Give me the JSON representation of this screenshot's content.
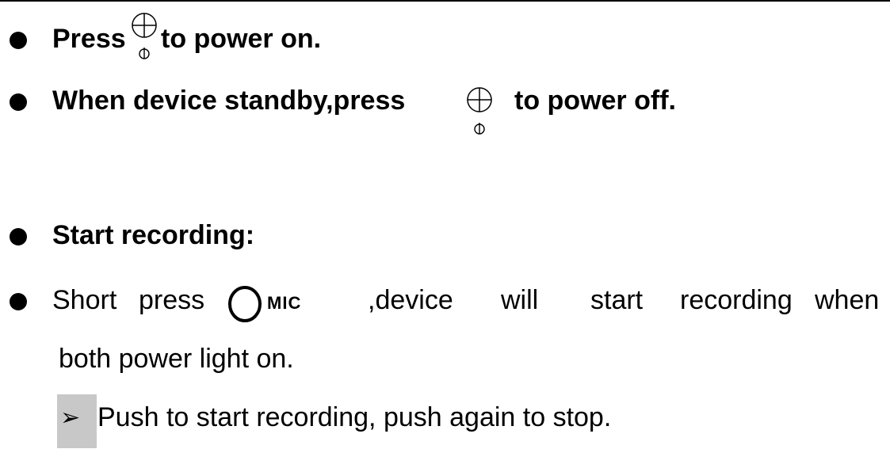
{
  "items": [
    {
      "before": "Press",
      "after": "to power on."
    },
    {
      "before": "When device standby,press",
      "after": "to power off."
    },
    {
      "text": "Start recording:"
    },
    {
      "words": [
        "Short",
        "press",
        ",device",
        "will",
        "start",
        "recording",
        "when"
      ],
      "continuation": "both power light on.",
      "icon_label": "MIC"
    },
    {
      "text": "Push to start recording, push again to stop.",
      "arrow": "➢"
    }
  ]
}
